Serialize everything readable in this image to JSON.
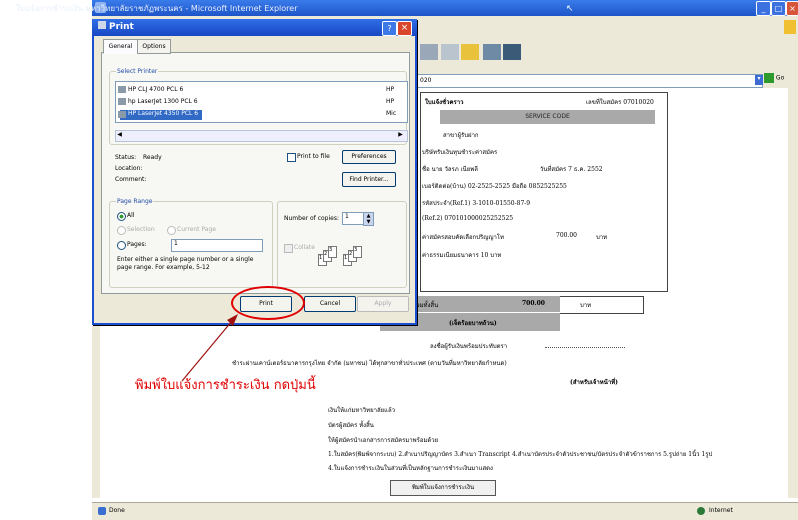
{
  "browser": {
    "title": "ใบแจ้งการชำระเงิน มหาวิทยาลัยราชภัฏพระนคร - Microsoft Internet Explorer",
    "address_value": "020",
    "go_label": "Go",
    "status": "Done",
    "zone": "Internet"
  },
  "dialog": {
    "title": "Print",
    "tabs": [
      "General",
      "Options"
    ],
    "select_printer_label": "Select Printer",
    "printers": [
      "HP CLJ 4700 PCL 6",
      "hp LaserJet 1300 PCL 6",
      "HP LaserJet 4350 PCL 6"
    ],
    "printers_right": [
      "HP",
      "HP",
      "Mic"
    ],
    "status_label": "Status:",
    "status_value": "Ready",
    "location_label": "Location:",
    "comment_label": "Comment:",
    "print_to_file_label": "Print to file",
    "preferences_label": "Preferences",
    "find_printer_label": "Find Printer...",
    "page_range_label": "Page Range",
    "range_all": "All",
    "range_selection": "Selection",
    "range_current": "Current Page",
    "range_pages": "Pages:",
    "pages_value": "1",
    "range_help": "Enter either a single page number or a single page range.  For example, 5-12",
    "copies_label": "Number of copies:",
    "copies_value": "1",
    "collate_label": "Collate",
    "collate_pages": [
      "1",
      "2",
      "3",
      "1",
      "2",
      "3"
    ],
    "print_button": "Print",
    "cancel_button": "Cancel",
    "apply_button": "Apply"
  },
  "invoice": {
    "heading": "ใบแจ้งชั่วคราว",
    "doc_no": "เลขที่ใบสมัคร 07010020",
    "service_code": "SERVICE CODE",
    "branch": "สาขาผู้รับฝาก",
    "line_company": "บริษัทรับเงินทุนชำระค่าสมัคร",
    "line_name": "ชื่อ นาย วัลรภ เนียพลี",
    "line_date": "วันที่สมัคร 7 ธ.ค. 2552",
    "line_phone": "เบอร์ติดต่อ(บ้าน) 02-2525-2525 มือถือ 0852525255",
    "line_ref1": "รหัสประจำ(Ref.1) 3-1010-01550-87-9",
    "line_ref2": "(Ref.2) 070101000025252525",
    "line_fee": "ค่าสมัครสอบคัดเลือกปริญญาโท",
    "fee_amount": "700.00",
    "fee_unit": "บาท",
    "line_bank_fee": "ค่าธรรมเนียมธนาคาร 10 บาท",
    "total_label": "รวมทั้งสิ้น",
    "total_amount": "700.00",
    "total_unit": "บาท",
    "amount_words": "(เจ็ดร้อยบาทถ้วน)",
    "received_by": "ลงชื่อผู้รับเงินพร้อมประทับตรา",
    "bank_note": "ชำระผ่านเคาน์เตอร์ธนาคารกรุงไทย จำกัด (มหาชน) ได้ทุกสาขาทั่วประเทศ (ตามวันที่มหาวิทยาลัยกำหนด)",
    "officer": "(สำหรับเจ้าหน้าที่)",
    "note1": "เงินให้แก่มหาวิทยาลัยแล้ว",
    "note2": "บัตรผู้สมัคร ทั้งสิ้น",
    "note3": "ให้ผู้สมัครนำเอกสารการสมัครมาพร้อมด้วย",
    "note4": "1.ใบสมัคร(พิมพ์จากระบบ) 2.สำเนาปริญญาบัตร 3.สำเนา Transcript 4.สำเนาบัตรประจำตัวประชาชน/บัตรประจำตัวข้าราชการ 5.รูปถ่าย 1นิ้ว 1รูป",
    "note5": "4.ใบแจ้งการชำระเงินในส่วนที่เป็นหลักฐานการชำระเงินมาแสดง",
    "print_invoice_button": "พิมพ์ใบแจ้งการชำระเงิน"
  },
  "annotation": "พิมพ์ใบแจ้งการชำระเงิน กดปุ่มนี้",
  "colors": {
    "highlight": "#e00000",
    "selection": "#316ac5",
    "titlebar": "#1d55c9"
  }
}
